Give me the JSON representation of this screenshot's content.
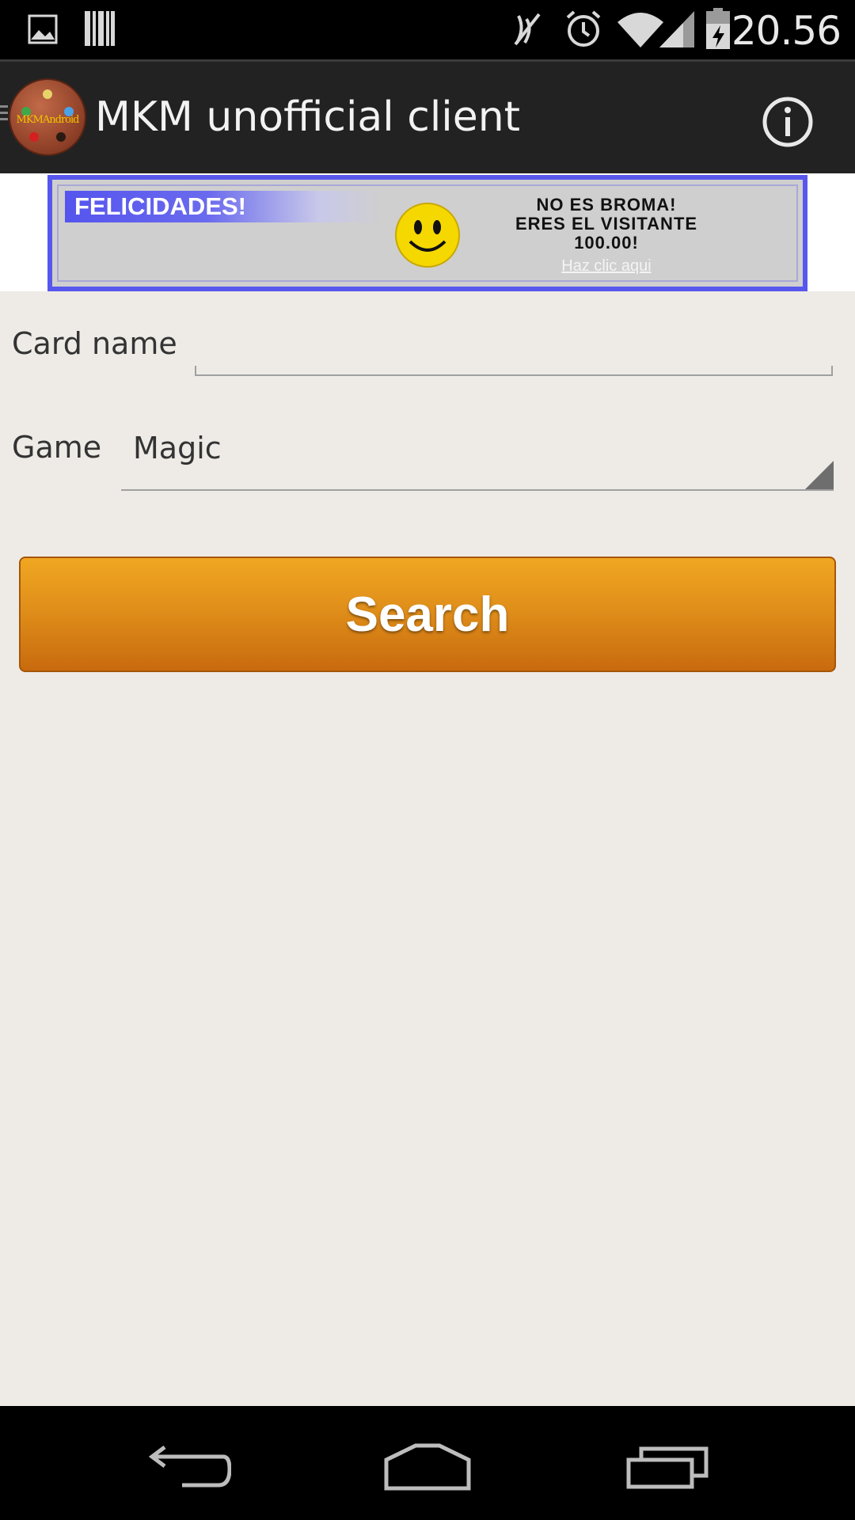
{
  "status_bar": {
    "time": "20.56",
    "icons": [
      "image-icon",
      "barcode-icon",
      "mute-icon",
      "alarm-icon",
      "wifi-icon",
      "signal-icon",
      "battery-icon"
    ]
  },
  "action_bar": {
    "title": "MKM unofficial client",
    "logo_text": "MKMAndroid",
    "info_icon": "info-icon"
  },
  "ad": {
    "headline": "FELICIDADES!",
    "line1": "NO ES BROMA!",
    "line2": "ERES EL VISITANTE",
    "line3": "100.00!",
    "link": "Haz clic aqui",
    "border_color": "#5757ee"
  },
  "form": {
    "card_name_label": "Card name",
    "card_name_value": "",
    "game_label": "Game",
    "game_value": "Magic",
    "search_label": "Search"
  },
  "colors": {
    "accent": "#e08f1a",
    "action_bar": "#222222",
    "background": "#eeebe7"
  },
  "nav_bar": {
    "icons": [
      "back-icon",
      "home-icon",
      "recent-apps-icon"
    ]
  }
}
